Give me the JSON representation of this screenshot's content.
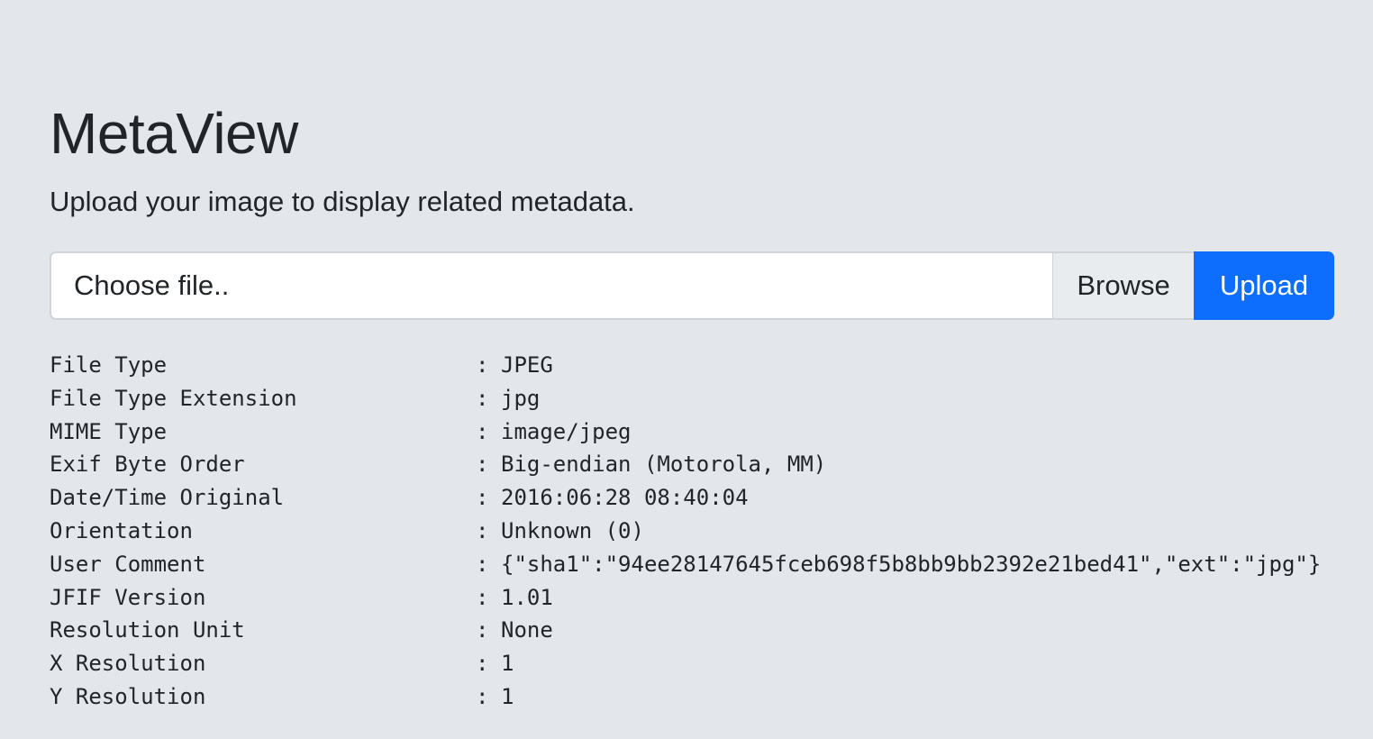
{
  "header": {
    "title": "MetaView",
    "subtitle": "Upload your image to display related metadata."
  },
  "upload_form": {
    "file_placeholder": "Choose file..",
    "browse_label": "Browse",
    "upload_label": "Upload",
    "accent_color": "#0d6efd"
  },
  "metadata": {
    "separator": ":",
    "rows": [
      {
        "key": "File Type",
        "value": "JPEG"
      },
      {
        "key": "File Type Extension",
        "value": "jpg"
      },
      {
        "key": "MIME Type",
        "value": "image/jpeg"
      },
      {
        "key": "Exif Byte Order",
        "value": "Big-endian (Motorola, MM)"
      },
      {
        "key": "Date/Time Original",
        "value": "2016:06:28 08:40:04"
      },
      {
        "key": "Orientation",
        "value": "Unknown (0)"
      },
      {
        "key": "User Comment",
        "value": "{\"sha1\":\"94ee28147645fceb698f5b8bb9bb2392e21bed41\",\"ext\":\"jpg\"}"
      },
      {
        "key": "JFIF Version",
        "value": "1.01"
      },
      {
        "key": "Resolution Unit",
        "value": "None"
      },
      {
        "key": "X Resolution",
        "value": "1"
      },
      {
        "key": "Y Resolution",
        "value": "1"
      }
    ]
  }
}
